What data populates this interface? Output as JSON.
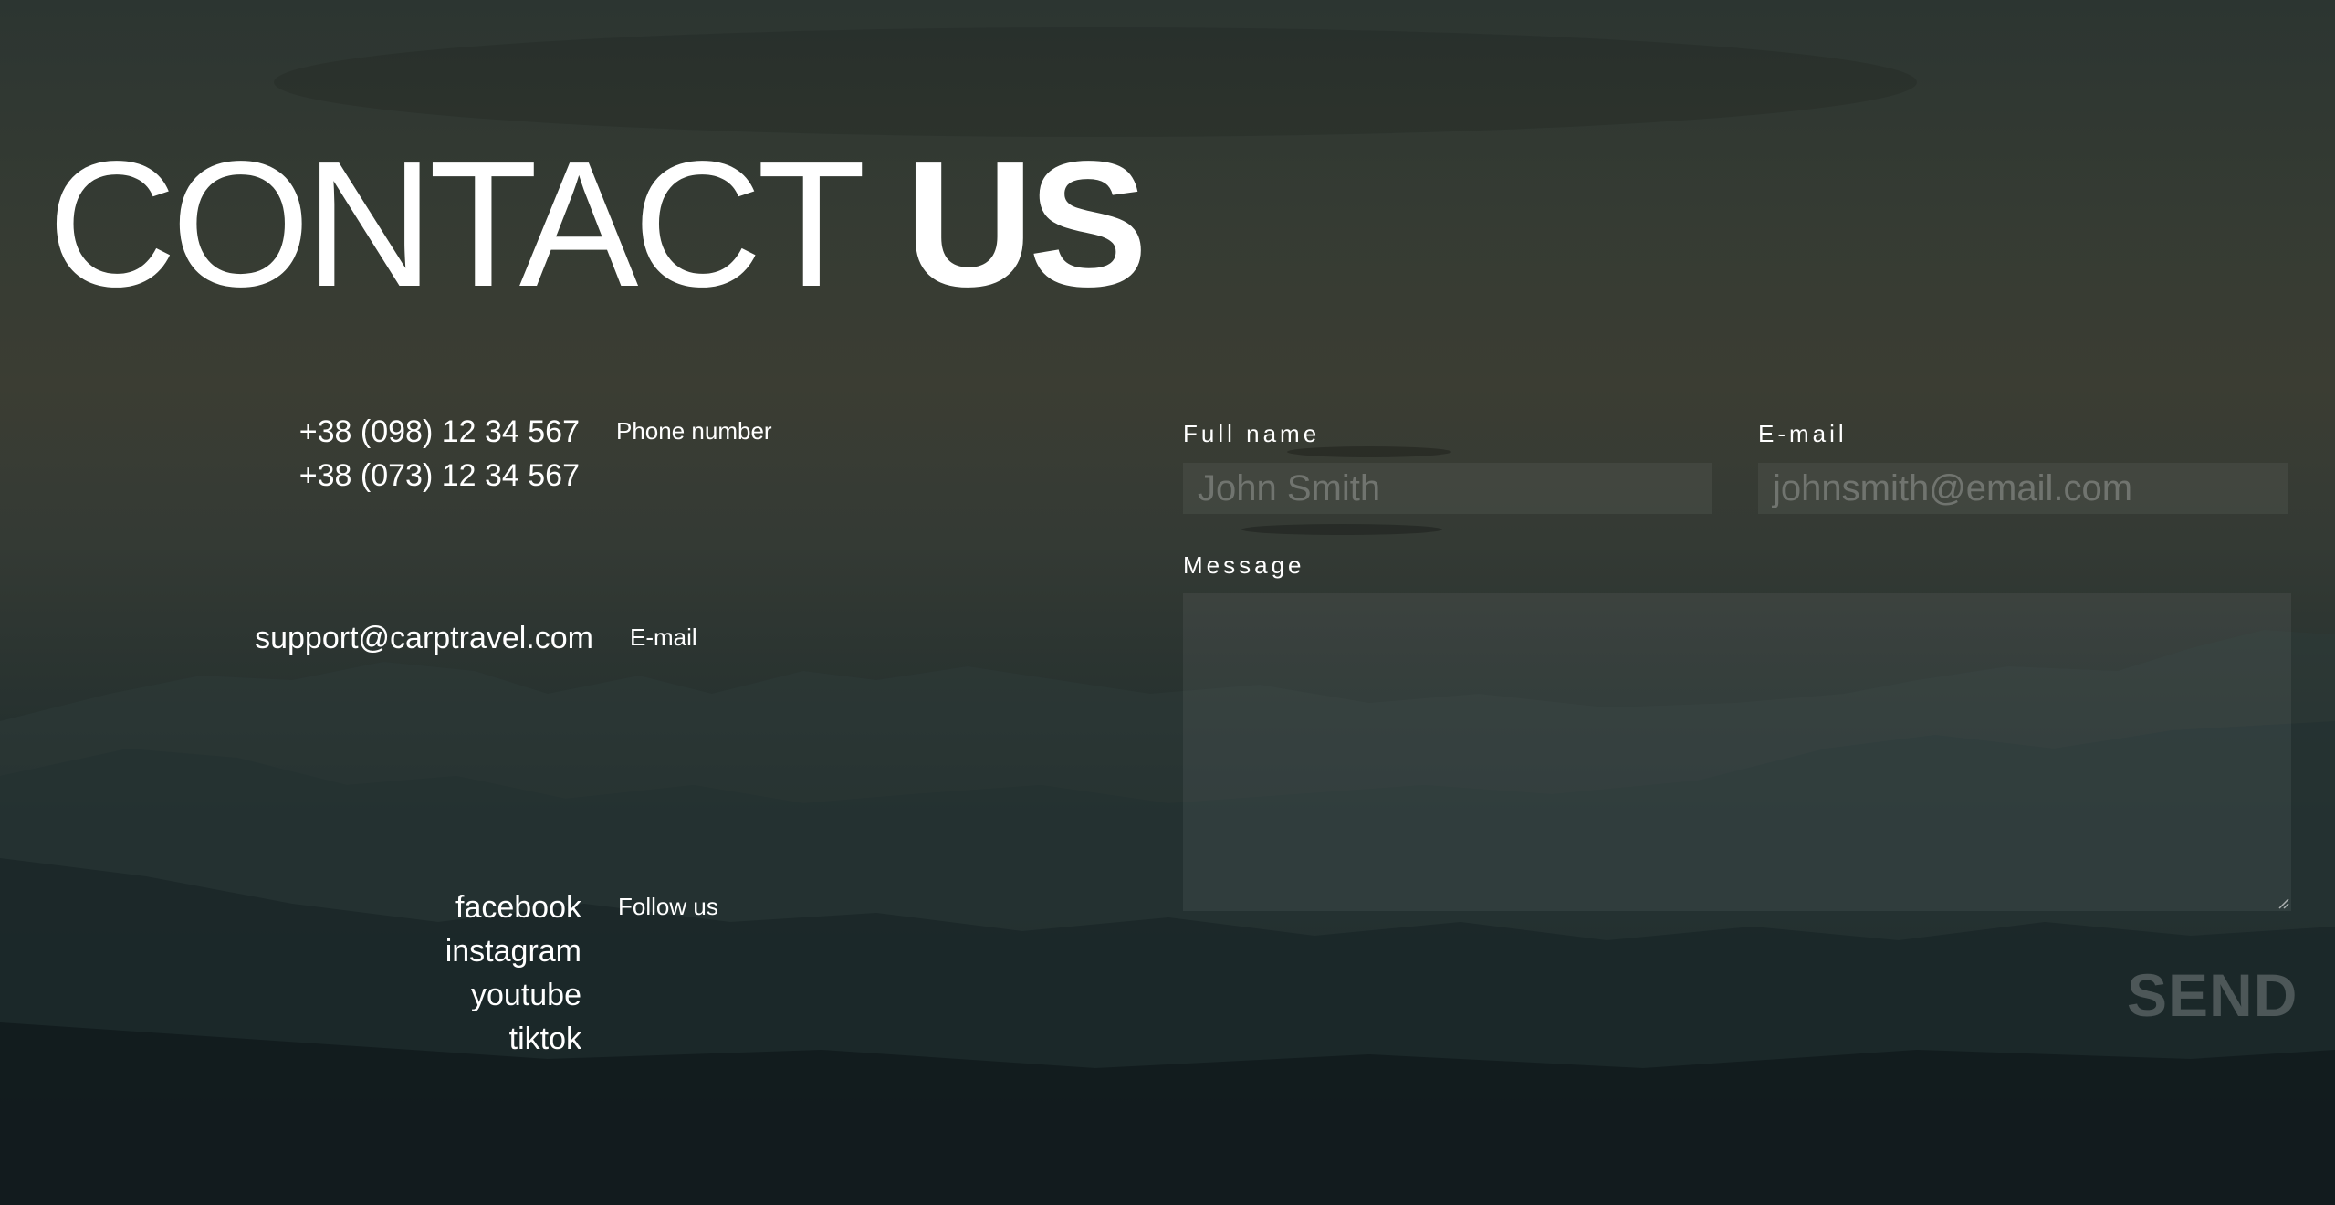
{
  "header": {
    "title_light": "CONTACT",
    "title_bold": "US"
  },
  "contacts": {
    "phones": [
      "+38 (098) 12 34 567",
      "+38 (073) 12 34 567"
    ],
    "phone_label": "Phone number",
    "email": "support@carptravel.com",
    "email_label": "E-mail",
    "socials": [
      "facebook",
      "instagram",
      "youtube",
      "tiktok"
    ],
    "socials_label": "Follow us"
  },
  "form": {
    "fullname_label": "Full name",
    "fullname_placeholder": "John Smith",
    "email_label": "E-mail",
    "email_placeholder": "johnsmith@email.com",
    "message_label": "Message",
    "send_label": "SEND"
  }
}
